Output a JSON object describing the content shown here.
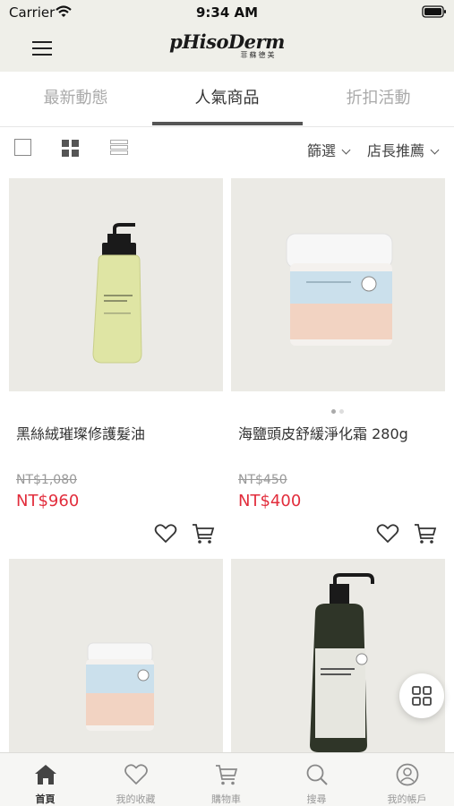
{
  "status_bar": {
    "carrier": "Carrier",
    "time": "9:34 AM"
  },
  "header": {
    "brand_name": "pHisoDerm",
    "brand_sub": "菲蘇德美",
    "menu_icon": "hamburger-icon"
  },
  "tabs": [
    {
      "label": "最新動態",
      "active": false
    },
    {
      "label": "人氣商品",
      "active": true
    },
    {
      "label": "折扣活動",
      "active": false
    }
  ],
  "filter_bar": {
    "view_modes": [
      "single-view-icon",
      "grid-view-icon",
      "list-view-icon"
    ],
    "filter_label": "篩選",
    "sort_label": "店長推薦"
  },
  "products": [
    {
      "name": "黑絲絨璀璨修護髮油",
      "old_price": "NT$1,080",
      "price": "NT$960",
      "image": "serum-bottle"
    },
    {
      "name": "海鹽頭皮舒緩淨化霜 280g",
      "old_price": "NT$450",
      "price": "NT$400",
      "image": "scrub-jar"
    },
    {
      "name": "",
      "old_price": "",
      "price": "",
      "image": "small-jar"
    },
    {
      "name": "",
      "old_price": "",
      "price": "",
      "image": "shampoo-bottle"
    }
  ],
  "bottom_nav": [
    {
      "label": "首頁",
      "icon": "home-icon",
      "active": true
    },
    {
      "label": "我的收藏",
      "icon": "heart-icon",
      "active": false
    },
    {
      "label": "購物車",
      "icon": "cart-icon",
      "active": false
    },
    {
      "label": "搜尋",
      "icon": "search-icon",
      "active": false
    },
    {
      "label": "我的帳戶",
      "icon": "account-icon",
      "active": false
    }
  ],
  "colors": {
    "accent_price": "#e22d3c",
    "header_bg": "#efefe9"
  }
}
